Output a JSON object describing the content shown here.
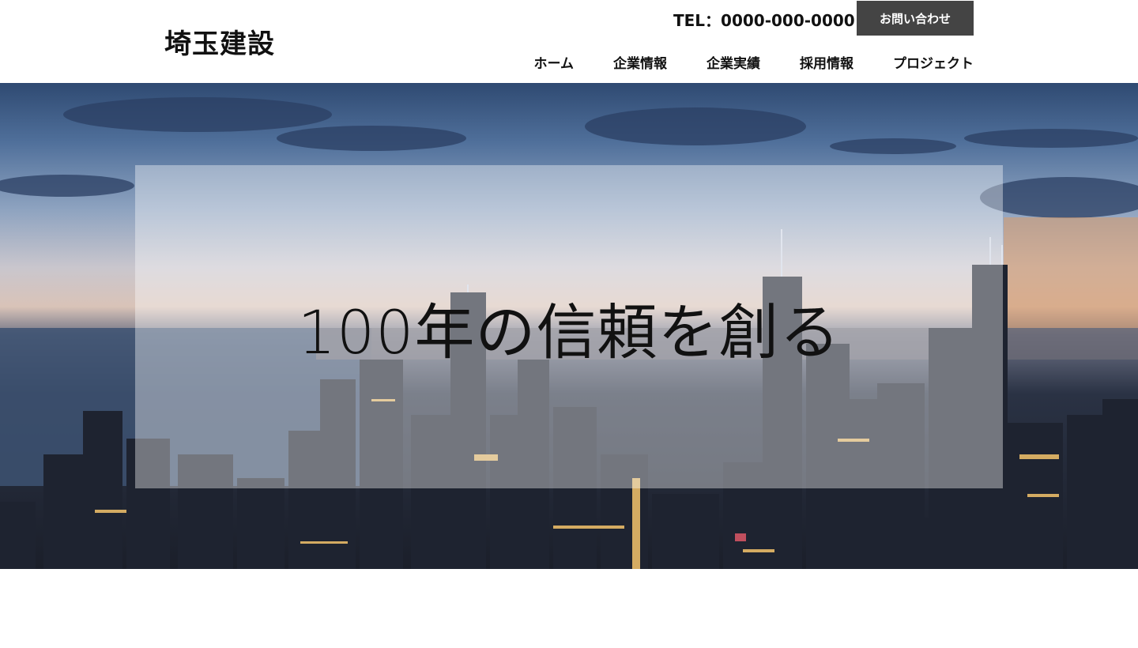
{
  "header": {
    "logo": "埼玉建設",
    "tel": "TEL：0000-000-0000",
    "contact_button": "お問い合わせ",
    "nav": [
      {
        "label": "ホーム"
      },
      {
        "label": "企業情報"
      },
      {
        "label": "企業実績"
      },
      {
        "label": "採用情報"
      },
      {
        "label": "プロジェクト"
      }
    ]
  },
  "hero": {
    "tagline": "100年の信頼を創る",
    "image_subject": "city-skyline-at-dusk"
  },
  "colors": {
    "button_bg": "#444444",
    "button_text": "#ffffff",
    "header_bg": "#ffffff"
  }
}
